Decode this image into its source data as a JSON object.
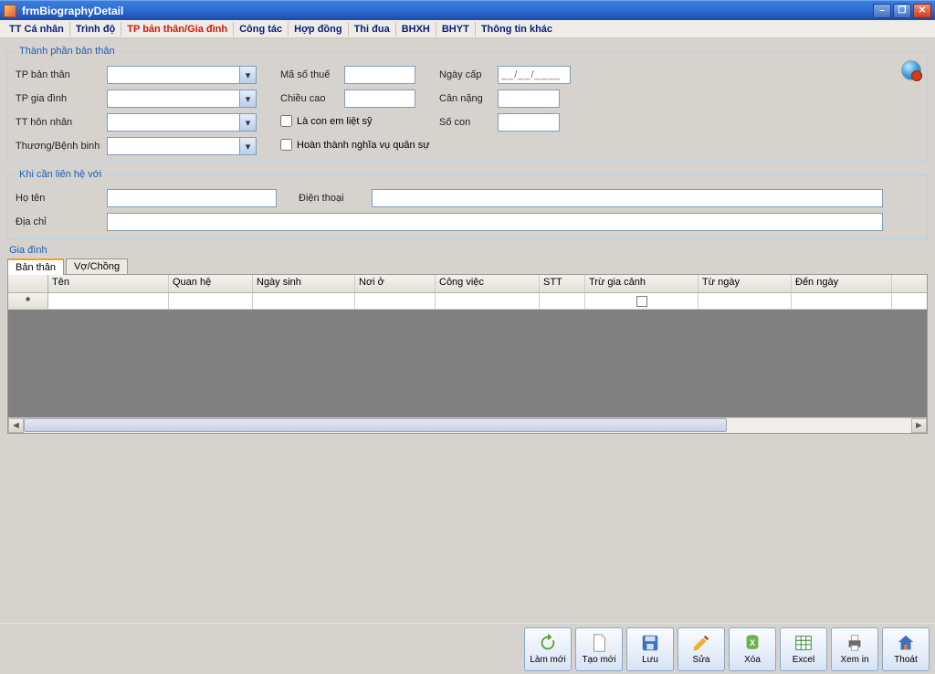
{
  "window": {
    "title": "frmBiographyDetail"
  },
  "menu": {
    "items": [
      {
        "label": "TT Cá nhân",
        "active": false
      },
      {
        "label": "Trình độ",
        "active": false
      },
      {
        "label": "TP bản thân/Gia đình",
        "active": true
      },
      {
        "label": "Công tác",
        "active": false
      },
      {
        "label": "Hợp đồng",
        "active": false
      },
      {
        "label": "Thi đua",
        "active": false
      },
      {
        "label": "BHXH",
        "active": false
      },
      {
        "label": "BHYT",
        "active": false
      },
      {
        "label": "Thông tin khác",
        "active": false
      }
    ]
  },
  "group_thanhphan": {
    "legend": "Thành phần bản thân",
    "tp_banthan_label": "TP bản thân",
    "tp_giadinh_label": "TP gia đình",
    "tt_honnhan_label": "TT hôn nhân",
    "thuong_label": "Thương/Bệnh binh",
    "masothue_label": "Mã số thuế",
    "chieucao_label": "Chiều cao",
    "la_con_em_label": "Là con em liệt sỹ",
    "hoanthanh_label": "Hoàn thành nghĩa vụ quân sự",
    "ngaycap_label": "Ngày cấp",
    "cannang_label": "Cân nặng",
    "socon_label": "Số con",
    "ngaycap_value": "__/__/____",
    "tp_banthan_value": "",
    "tp_giadinh_value": "",
    "tt_honnhan_value": "",
    "thuong_value": "",
    "masothue_value": "",
    "chieucao_value": "",
    "cannang_value": "",
    "socon_value": ""
  },
  "group_lienhe": {
    "legend": "Khi cần liên hệ với",
    "hoten_label": "Họ tên",
    "dienthoai_label": "Điện thoại",
    "diachi_label": "Địa chỉ",
    "hoten_value": "",
    "dienthoai_value": "",
    "diachi_value": ""
  },
  "giadinh_label": "Gia đình",
  "tabs": {
    "banthan": "Bản thân",
    "vochong": "Vợ/Chồng"
  },
  "grid": {
    "columns": {
      "ten": "Tên",
      "quanhe": "Quan hệ",
      "ngaysinh": "Ngày sinh",
      "noio": "Nơi ở",
      "congviec": "Công việc",
      "stt": "STT",
      "trugiacanh": "Trừ gia cảnh",
      "tungay": "Từ ngày",
      "denngay": "Đến ngày"
    },
    "newrow_marker": "*"
  },
  "toolbar": {
    "lammoi": "Làm mới",
    "taomoi": "Tạo mới",
    "luu": "Lưu",
    "sua": "Sửa",
    "xoa": "Xóa",
    "excel": "Excel",
    "xemin": "Xem in",
    "thoat": "Thoát"
  }
}
